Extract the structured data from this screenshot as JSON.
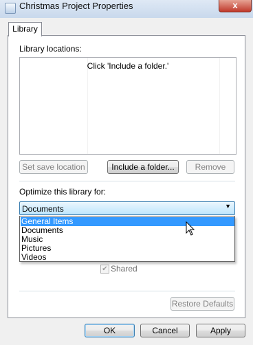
{
  "window": {
    "title": "Christmas Project Properties",
    "close_label": "x"
  },
  "tabs": [
    {
      "label": "Library"
    }
  ],
  "library_locations": {
    "label": "Library locations:",
    "hint": "Click 'Include a folder.'"
  },
  "buttons": {
    "set_save_location": "Set save location",
    "include_folder": "Include a folder...",
    "remove": "Remove",
    "restore_defaults": "Restore Defaults",
    "ok": "OK",
    "cancel": "Cancel",
    "apply": "Apply"
  },
  "optimize": {
    "label": "Optimize this library for:",
    "selected": "Documents",
    "options": [
      "General Items",
      "Documents",
      "Music",
      "Pictures",
      "Videos"
    ],
    "highlighted": "General Items"
  },
  "shared": {
    "label": "Shared",
    "checked": true,
    "enabled": false
  }
}
